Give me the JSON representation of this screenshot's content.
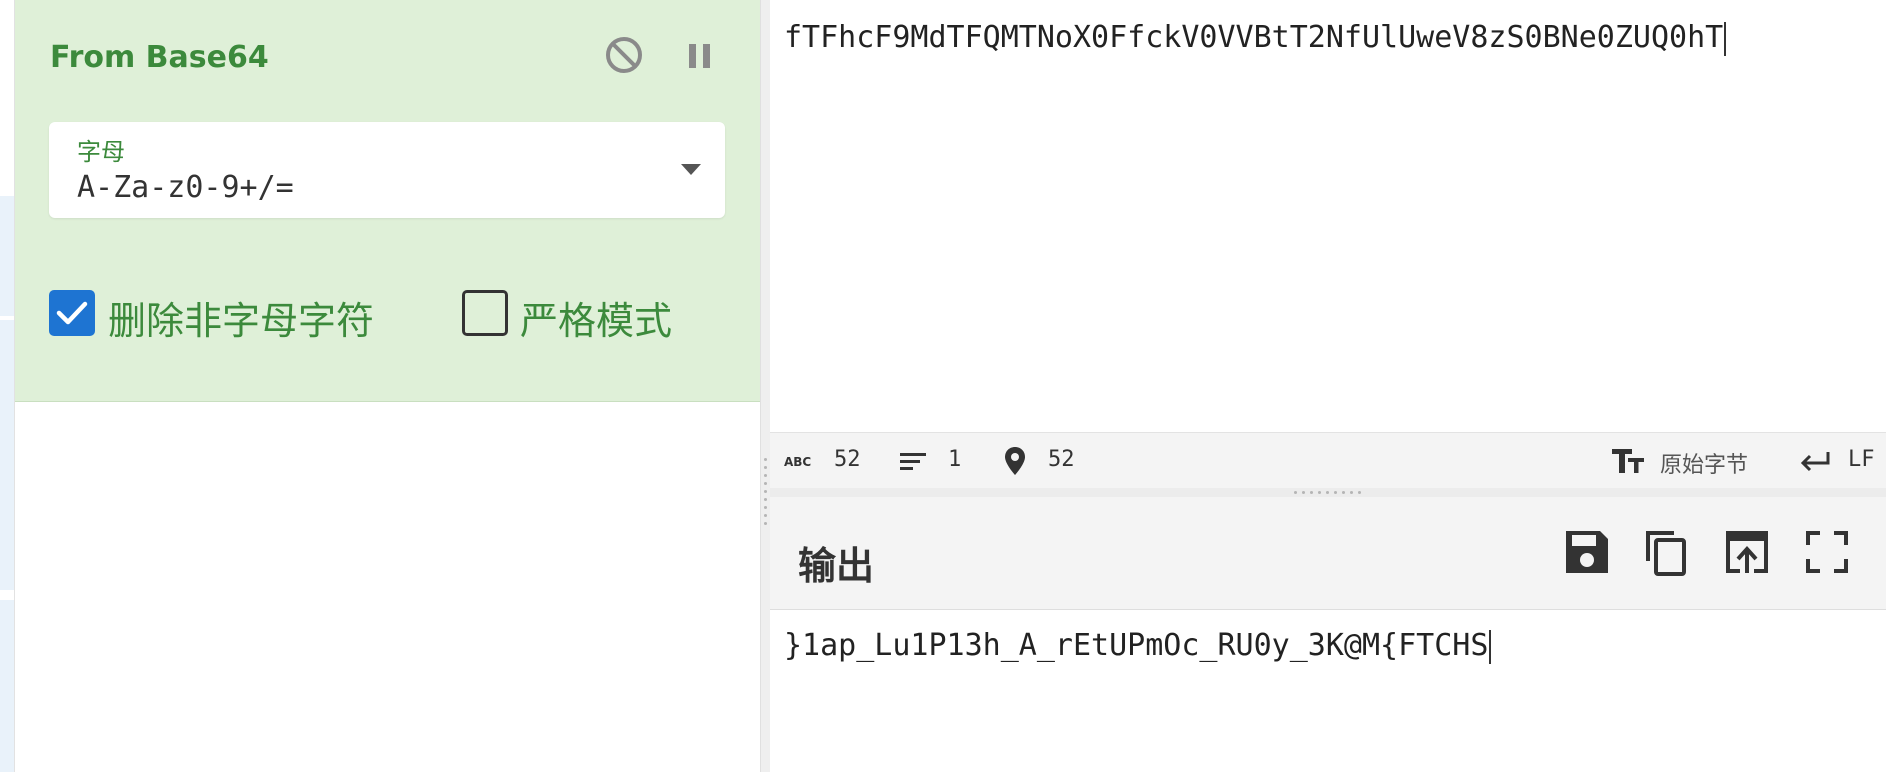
{
  "recipe": {
    "operation": {
      "title": "From Base64",
      "alphabet": {
        "label": "字母",
        "value": "A-Za-z0-9+/="
      },
      "options": {
        "remove_non_alphabet": {
          "label": "删除非字母字符",
          "checked": true
        },
        "strict_mode": {
          "label": "严格模式",
          "checked": false
        }
      }
    }
  },
  "input": {
    "text": "fTFhcF9MdTFQMTNoX0FfckV0VVBtT2NfUlUweV8zS0BNe0ZUQ0hT"
  },
  "status_bar": {
    "length": "52",
    "lines": "1",
    "position": "52",
    "encoding": "原始字节",
    "eol": "LF"
  },
  "output": {
    "title": "输出",
    "text": "}1ap_Lu1P13h_A_rEtUPmOc_RU0y_3K@M{FTCHS"
  },
  "colors": {
    "op_card_bg": "#dff0d8",
    "op_green": "#3c8a3c",
    "checkbox_blue": "#1e74d2"
  },
  "icons": {
    "disable": "disable-icon",
    "pause": "pause-icon",
    "dropdown": "chevron-down-icon",
    "length": "abc-icon",
    "lines": "lines-icon",
    "position": "location-pin-icon",
    "encoding": "text-size-icon",
    "eol": "return-arrow-icon",
    "save": "save-icon",
    "copy": "copy-icon",
    "replace_input": "move-to-input-icon",
    "maximise": "fullscreen-icon"
  }
}
